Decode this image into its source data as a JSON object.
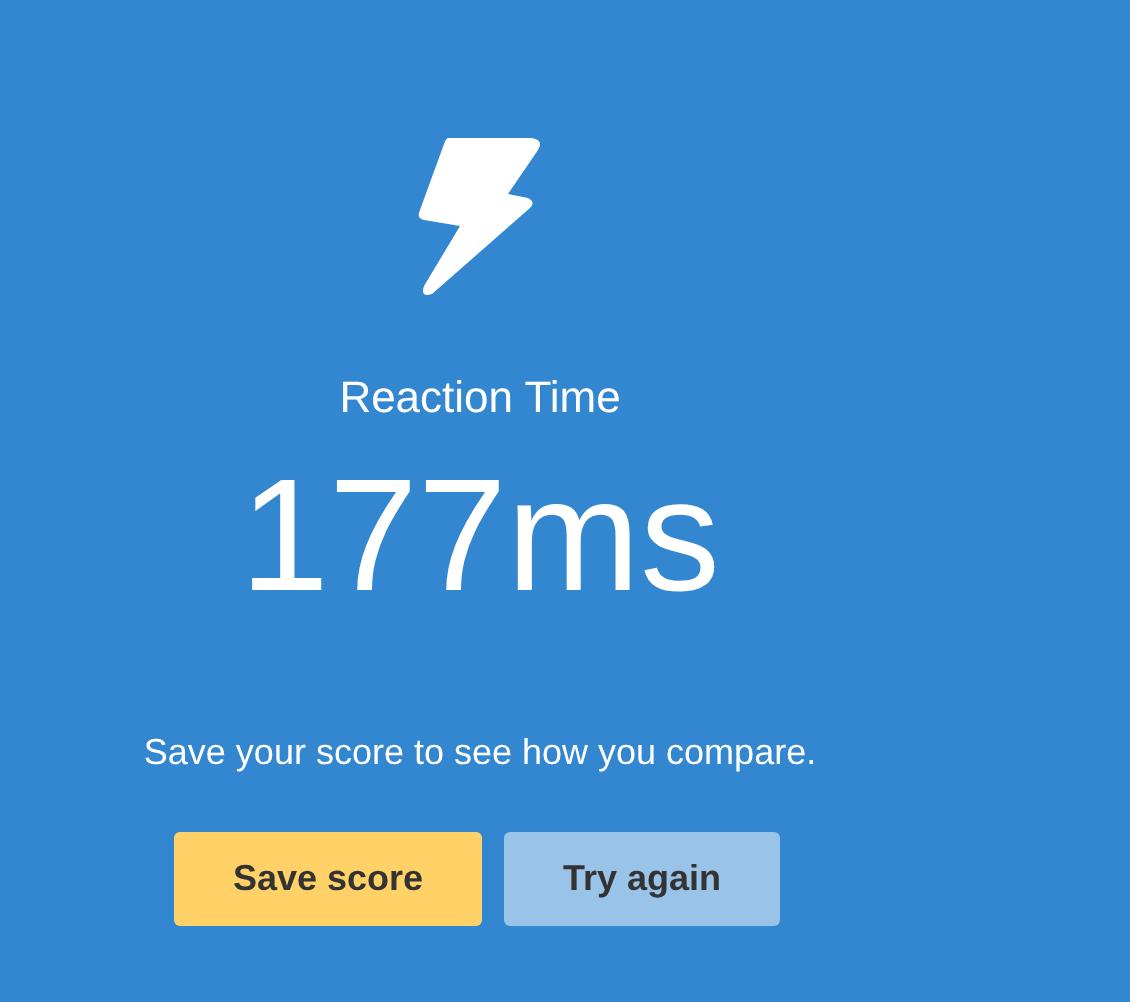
{
  "title": "Reaction Time",
  "result": "177ms",
  "message": "Save your score to see how you compare.",
  "buttons": [
    {
      "label": "Save score",
      "kind": "primary"
    },
    {
      "label": "Try again",
      "kind": "secondary"
    }
  ]
}
